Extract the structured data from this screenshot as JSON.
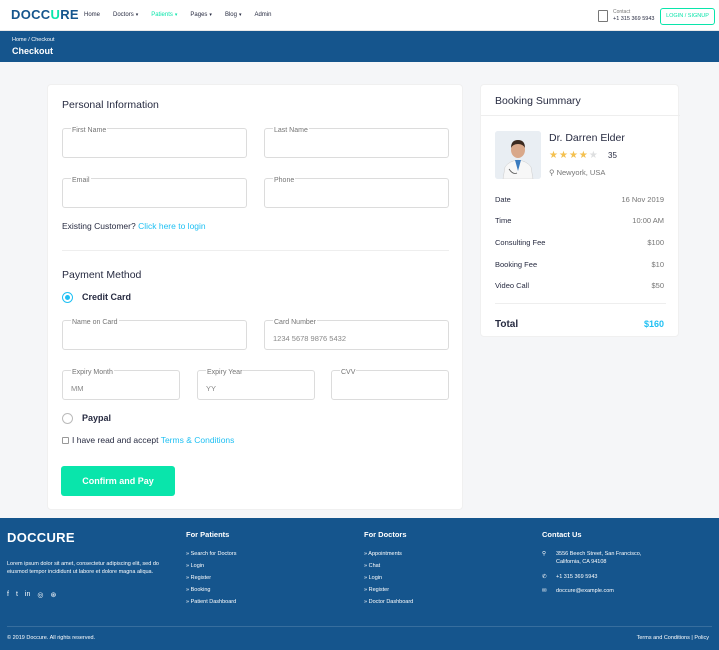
{
  "header": {
    "logo_main": "DOCC",
    "logo_accent": "U",
    "logo_tail": "RE",
    "nav": [
      {
        "label": "Home",
        "caret": false
      },
      {
        "label": "Doctors",
        "caret": true
      },
      {
        "label": "Patients",
        "caret": true,
        "active": true
      },
      {
        "label": "Pages",
        "caret": true
      },
      {
        "label": "Blog",
        "caret": true
      },
      {
        "label": "Admin",
        "caret": false
      }
    ],
    "contact_label": "Contact",
    "contact_phone": "+1 315 369 5943",
    "login_button": "LOGIN / SIGNUP"
  },
  "breadcrumb": {
    "path": "Home / Checkout",
    "title": "Checkout"
  },
  "form": {
    "personal_title": "Personal Information",
    "first_name_label": "First Name",
    "last_name_label": "Last Name",
    "email_label": "Email",
    "phone_label": "Phone",
    "existing_text": "Existing Customer?",
    "login_link": "Click here to login",
    "payment_title": "Payment Method",
    "credit_card_label": "Credit Card",
    "name_on_card_label": "Name on Card",
    "card_number_label": "Card Number",
    "card_number_placeholder": "1234  5678  9876  5432",
    "expiry_month_label": "Expiry Month",
    "expiry_month_placeholder": "MM",
    "expiry_year_label": "Expiry Year",
    "expiry_year_placeholder": "YY",
    "cvv_label": "CVV",
    "paypal_label": "Paypal",
    "terms_text": "I have read and accept",
    "terms_link": "Terms & Conditions",
    "pay_button": "Confirm and Pay"
  },
  "summary": {
    "title": "Booking Summary",
    "doctor_name": "Dr. Darren Elder",
    "rating": "35",
    "location": "Newyork, USA",
    "rows": [
      {
        "label": "Date",
        "value": "16 Nov 2019"
      },
      {
        "label": "Time",
        "value": "10:00 AM"
      },
      {
        "label": "Consulting Fee",
        "value": "$100"
      },
      {
        "label": "Booking Fee",
        "value": "$10"
      },
      {
        "label": "Video Call",
        "value": "$50"
      }
    ],
    "total_label": "Total",
    "total_value": "$160"
  },
  "footer": {
    "logo": "DOCCURE",
    "about": "Lorem ipsum dolor sit amet, consectetur adipiscing elit, sed do eiusmod tempor incididunt ut labore et dolore magna aliqua.",
    "patients_title": "For Patients",
    "patients_links": [
      "Search for Doctors",
      "Login",
      "Register",
      "Booking",
      "Patient Dashboard"
    ],
    "doctors_title": "For Doctors",
    "doctors_links": [
      "Appointments",
      "Chat",
      "Login",
      "Register",
      "Doctor Dashboard"
    ],
    "contact_title": "Contact Us",
    "address_line1": "3556 Beech Street, San Francisco,",
    "address_line2": "California, CA 94108",
    "phone": "+1 315 369 5943",
    "email": "doccure@example.com",
    "copyright": "© 2019 Doccure. All rights reserved.",
    "terms": "Terms and Conditions",
    "policy": "Policy"
  },
  "colors": {
    "primary": "#15558d",
    "accent": "#09e5ab",
    "link": "#20c0f3",
    "star": "#f4c150"
  }
}
